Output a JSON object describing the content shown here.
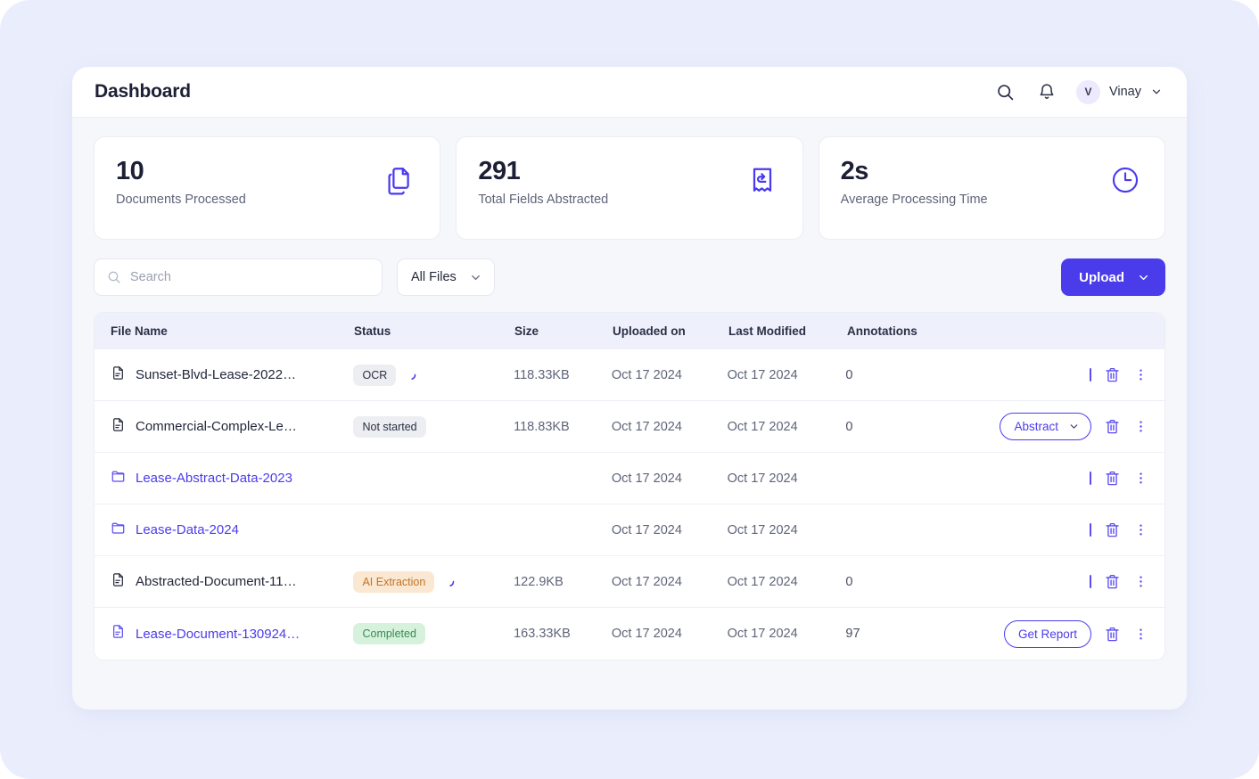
{
  "header": {
    "title": "Dashboard",
    "search_icon": "search-icon",
    "bell_icon": "bell-icon",
    "avatar_initial": "V",
    "user_name": "Vinay",
    "caret_icon": "chevron-down-icon"
  },
  "stats": [
    {
      "value": "10",
      "label": "Documents Processed",
      "icon": "documents-copy-icon"
    },
    {
      "value": "291",
      "label": "Total Fields Abstracted",
      "icon": "bookmark-undo-icon"
    },
    {
      "value": "2s",
      "label": "Average Processing Time",
      "icon": "clock-icon"
    }
  ],
  "toolbar": {
    "search_placeholder": "Search",
    "search_value": "",
    "filter_label": "All Files",
    "filter_options": [
      "All Files"
    ],
    "upload_label": "Upload"
  },
  "table": {
    "columns": [
      "File Name",
      "Status",
      "Size",
      "Uploaded on",
      "Last Modified",
      "Annotations"
    ],
    "rows": [
      {
        "name": "Sunset-Blvd-Lease-2022…",
        "kind": "file",
        "link": false,
        "status": "OCR",
        "status_style": "gray",
        "spinner": true,
        "size": "118.33KB",
        "uploaded_on": "Oct 17 2024",
        "last_modified": "Oct 17 2024",
        "annotations": "0",
        "action": "none"
      },
      {
        "name": "Commercial-Complex-Le…",
        "kind": "file",
        "link": false,
        "status": "Not started",
        "status_style": "gray",
        "spinner": false,
        "size": "118.83KB",
        "uploaded_on": "Oct 17 2024",
        "last_modified": "Oct 17 2024",
        "annotations": "0",
        "action": "dropdown",
        "action_label": "Abstract"
      },
      {
        "name": "Lease-Abstract-Data-2023",
        "kind": "folder",
        "link": true,
        "status": "",
        "status_style": "none",
        "spinner": false,
        "size": "",
        "uploaded_on": "Oct 17 2024",
        "last_modified": "Oct 17 2024",
        "annotations": "",
        "action": "none"
      },
      {
        "name": "Lease-Data-2024",
        "kind": "folder",
        "link": true,
        "status": "",
        "status_style": "none",
        "spinner": false,
        "size": "",
        "uploaded_on": "Oct 17 2024",
        "last_modified": "Oct 17 2024",
        "annotations": "",
        "action": "none"
      },
      {
        "name": "Abstracted-Document-11…",
        "kind": "file",
        "link": false,
        "status": "AI Extraction",
        "status_style": "orange",
        "spinner": true,
        "size": "122.9KB",
        "uploaded_on": "Oct 17 2024",
        "last_modified": "Oct 17 2024",
        "annotations": "0",
        "action": "none"
      },
      {
        "name": "Lease-Document-130924…",
        "kind": "file",
        "link": true,
        "status": "Completed",
        "status_style": "green",
        "spinner": false,
        "size": "163.33KB",
        "uploaded_on": "Oct 17 2024",
        "last_modified": "Oct 17 2024",
        "annotations": "97",
        "action": "button",
        "action_label": "Get Report"
      }
    ],
    "row_icons": {
      "delete": "trash-icon",
      "more": "more-vertical-icon",
      "divider": "divider-bar"
    }
  },
  "colors": {
    "accent": "#4b3ceb",
    "page_bg": "#eaeefc",
    "app_bg": "#f6f7fb",
    "header_row_bg": "#eef1fb",
    "badge_gray_bg": "#eceef2",
    "badge_orange_bg": "#fbe8d2",
    "badge_orange_text": "#c27327",
    "badge_green_bg": "#d6f2dd",
    "badge_green_text": "#3b8a52"
  }
}
